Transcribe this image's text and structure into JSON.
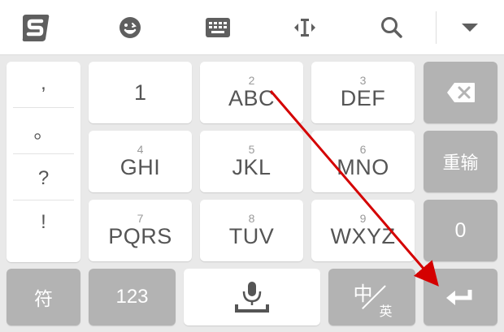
{
  "toolbar": {
    "icons": [
      "sogou-logo-icon",
      "emoji-icon",
      "keyboard-icon",
      "cursor-icon",
      "search-icon",
      "collapse-icon"
    ]
  },
  "punctuation": [
    ",",
    "。",
    "?",
    "!"
  ],
  "keys": {
    "k1": {
      "letters": "1"
    },
    "k2": {
      "num": "2",
      "letters": "ABC"
    },
    "k3": {
      "num": "3",
      "letters": "DEF"
    },
    "k4": {
      "num": "4",
      "letters": "GHI"
    },
    "k5": {
      "num": "5",
      "letters": "JKL"
    },
    "k6": {
      "num": "6",
      "letters": "MNO"
    },
    "k7": {
      "num": "7",
      "letters": "PQRS"
    },
    "k8": {
      "num": "8",
      "letters": "TUV"
    },
    "k9": {
      "num": "9",
      "letters": "WXYZ"
    }
  },
  "side": {
    "reenter": "重输",
    "zero": "0"
  },
  "bottom": {
    "symbols": "符",
    "numbers": "123",
    "lang_main": "中",
    "lang_sub": "英"
  },
  "colors": {
    "gray_key": "#b3b3b3",
    "white_key": "#ffffff",
    "arrow": "#d40000"
  }
}
